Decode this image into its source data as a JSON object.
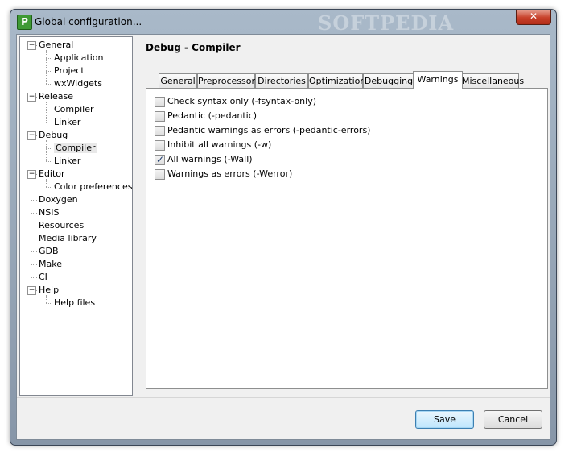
{
  "window": {
    "title": "Global configuration...",
    "app_icon": "P",
    "watermark": "SOFTPEDIA"
  },
  "tree": {
    "items": [
      {
        "label": "General",
        "level": 0,
        "expander": "−"
      },
      {
        "label": "Application",
        "level": 1
      },
      {
        "label": "Project",
        "level": 1
      },
      {
        "label": "wxWidgets",
        "level": 1
      },
      {
        "label": "Release",
        "level": 0,
        "expander": "−"
      },
      {
        "label": "Compiler",
        "level": 1
      },
      {
        "label": "Linker",
        "level": 1
      },
      {
        "label": "Debug",
        "level": 0,
        "expander": "−"
      },
      {
        "label": "Compiler",
        "level": 1,
        "selected": true
      },
      {
        "label": "Linker",
        "level": 1
      },
      {
        "label": "Editor",
        "level": 0,
        "expander": "−"
      },
      {
        "label": "Color preferences",
        "level": 1
      },
      {
        "label": "Doxygen",
        "level": 0
      },
      {
        "label": "NSIS",
        "level": 0
      },
      {
        "label": "Resources",
        "level": 0
      },
      {
        "label": "Media library",
        "level": 0
      },
      {
        "label": "GDB",
        "level": 0
      },
      {
        "label": "Make",
        "level": 0
      },
      {
        "label": "CI",
        "level": 0
      },
      {
        "label": "Help",
        "level": 0,
        "expander": "−"
      },
      {
        "label": "Help files",
        "level": 1
      }
    ]
  },
  "panel": {
    "title": "Debug - Compiler",
    "tabs": [
      {
        "label": "General"
      },
      {
        "label": "Preprocessor"
      },
      {
        "label": "Directories"
      },
      {
        "label": "Optimization"
      },
      {
        "label": "Debugging"
      },
      {
        "label": "Warnings",
        "active": true
      },
      {
        "label": "Miscellaneous"
      }
    ],
    "options": [
      {
        "label": "Check syntax only (-fsyntax-only)",
        "checked": false
      },
      {
        "label": "Pedantic (-pedantic)",
        "checked": false
      },
      {
        "label": "Pedantic warnings as errors (-pedantic-errors)",
        "checked": false
      },
      {
        "label": "Inhibit all warnings (-w)",
        "checked": false
      },
      {
        "label": "All warnings (-Wall)",
        "checked": true
      },
      {
        "label": "Warnings as errors (-Werror)",
        "checked": false
      }
    ]
  },
  "buttons": {
    "save": "Save",
    "cancel": "Cancel",
    "close_glyph": "✕"
  }
}
